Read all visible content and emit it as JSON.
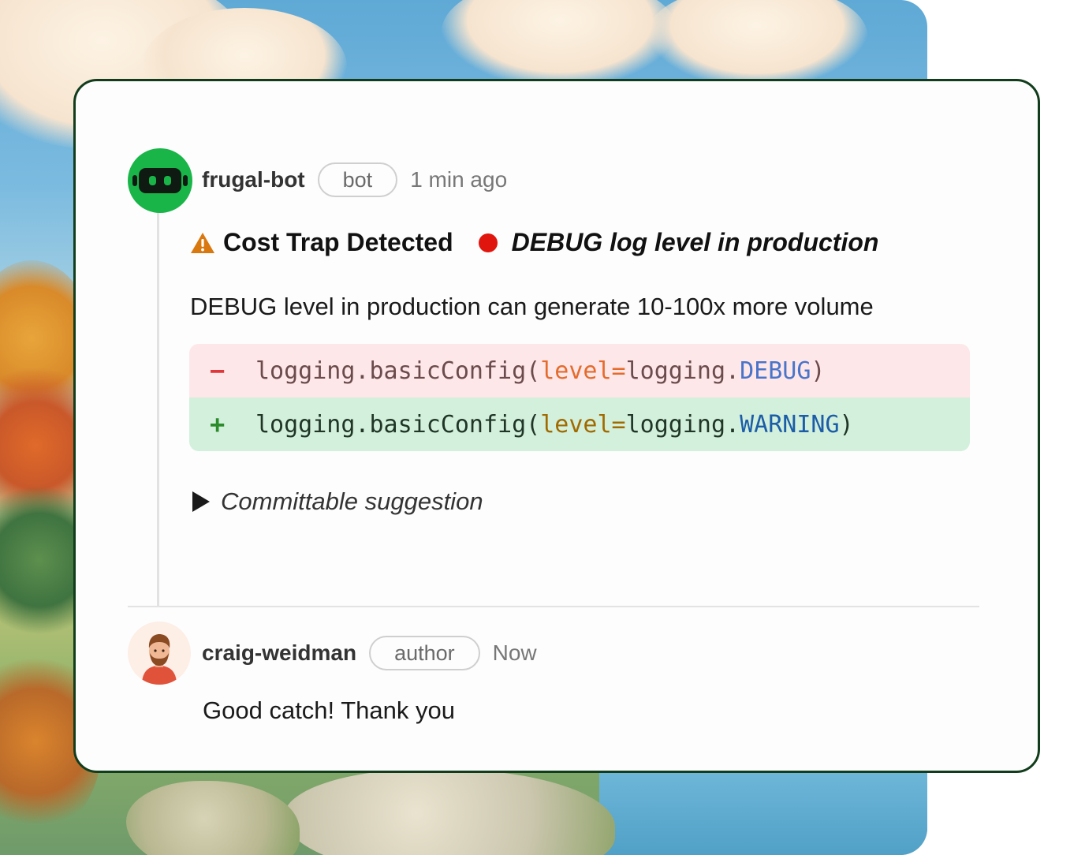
{
  "bot_comment": {
    "username": "frugal-bot",
    "badge": "bot",
    "time": "1 min ago",
    "avatar_icon": "robot-icon",
    "headline_icon": "warning-icon",
    "headline_title": "Cost Trap Detected",
    "severity_icon": "red-dot-icon",
    "headline_issue": "DEBUG log level in production",
    "description": "DEBUG level in production can generate 10-100x more volume",
    "diff": {
      "removed": {
        "sign": "−",
        "prefix": "logging.basicConfig(",
        "keyword": "level=",
        "module": "logging.",
        "constant": "DEBUG",
        "suffix": ")"
      },
      "added": {
        "sign": "+",
        "prefix": "logging.basicConfig(",
        "keyword": "level=",
        "module": "logging.",
        "constant": "WARNING",
        "suffix": ")"
      }
    },
    "suggestion_label": "Committable suggestion"
  },
  "reply_comment": {
    "username": "craig-weidman",
    "badge": "author",
    "time": "Now",
    "avatar_icon": "user-avatar-icon",
    "body": "Good catch! Thank you"
  },
  "colors": {
    "card_border": "#123d1d",
    "bot_avatar_bg": "#19b548",
    "removed_bg": "#fde7e9",
    "added_bg": "#d3f0dc",
    "severity_red": "#e0150d",
    "warning_orange": "#d9780f"
  }
}
